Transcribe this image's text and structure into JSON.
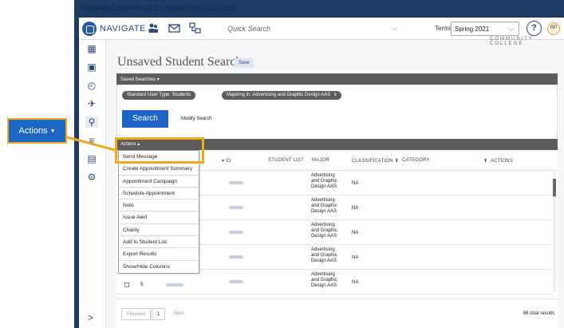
{
  "window": {
    "college_name": "ROWAN-CABARRUS COMMUNITY COLLEGE"
  },
  "topnav": {
    "navigate_label": "NAVIGATE",
    "quick_search_placeholder": "Quick Search",
    "terms_label": "Terms",
    "terms_value": "Spring 2021",
    "help_glyph": "?",
    "avatar_initials": "RP",
    "banner_text": "COMMUNITY COLLEGE"
  },
  "rail": {
    "icons": [
      "calendar-icon",
      "inbox-icon",
      "history-icon",
      "pin-icon",
      "search-icon",
      "list-icon",
      "report-icon",
      "gear-icon"
    ],
    "expand_glyph": ">"
  },
  "main": {
    "page_title": "Unsaved Student Search",
    "save_label": "Save",
    "saved_searches_label": "Saved Searches ▾",
    "chips": [
      {
        "label": "Standard User Type: Students"
      },
      {
        "label": "Majoring in: Advertising and Graphic Design AAS",
        "close": "x"
      }
    ],
    "search_button": "Search",
    "modify_search": "Modify Search",
    "actions_toggle": "Actions ▴",
    "columns": {
      "id": "ID",
      "student_list": "STUDENT LIST",
      "major": "MAJOR",
      "classification": "CLASSIFICATION",
      "category": "CATEGORY",
      "actions": "ACTIONS"
    },
    "rows": [
      {
        "major": "Advertising and Graphic Design AAS",
        "classification": "NA"
      },
      {
        "major": "Advertising and Graphic Design AAS",
        "classification": "NA"
      },
      {
        "major": "Advertising and Graphic Design AAS",
        "classification": "NA"
      },
      {
        "major": "Advertising and Graphic Design AAS",
        "classification": "NA"
      },
      {
        "major": "Advertising and Graphic Design AAS",
        "classification": "NA",
        "number": "5"
      }
    ],
    "pager": {
      "previous": "Previous",
      "current_page": "1",
      "next": "Next",
      "total_results": "86 total results"
    }
  },
  "actions_menu": {
    "items": [
      "Send Message",
      "Create Appointment Summary",
      "Appointment Campaign",
      "Schedule Appointment",
      "Note",
      "Issue Alert",
      "Charity",
      "Add to Student List",
      "Export Results",
      "Show/Hide Columns"
    ]
  },
  "callout": {
    "label": "Actions",
    "glyph": "▼"
  },
  "colors": {
    "highlight": "#f0a81c",
    "callout_bg": "#1c66c4",
    "dark_bar": "#5d5d5d",
    "search_button": "#1e64c8"
  }
}
